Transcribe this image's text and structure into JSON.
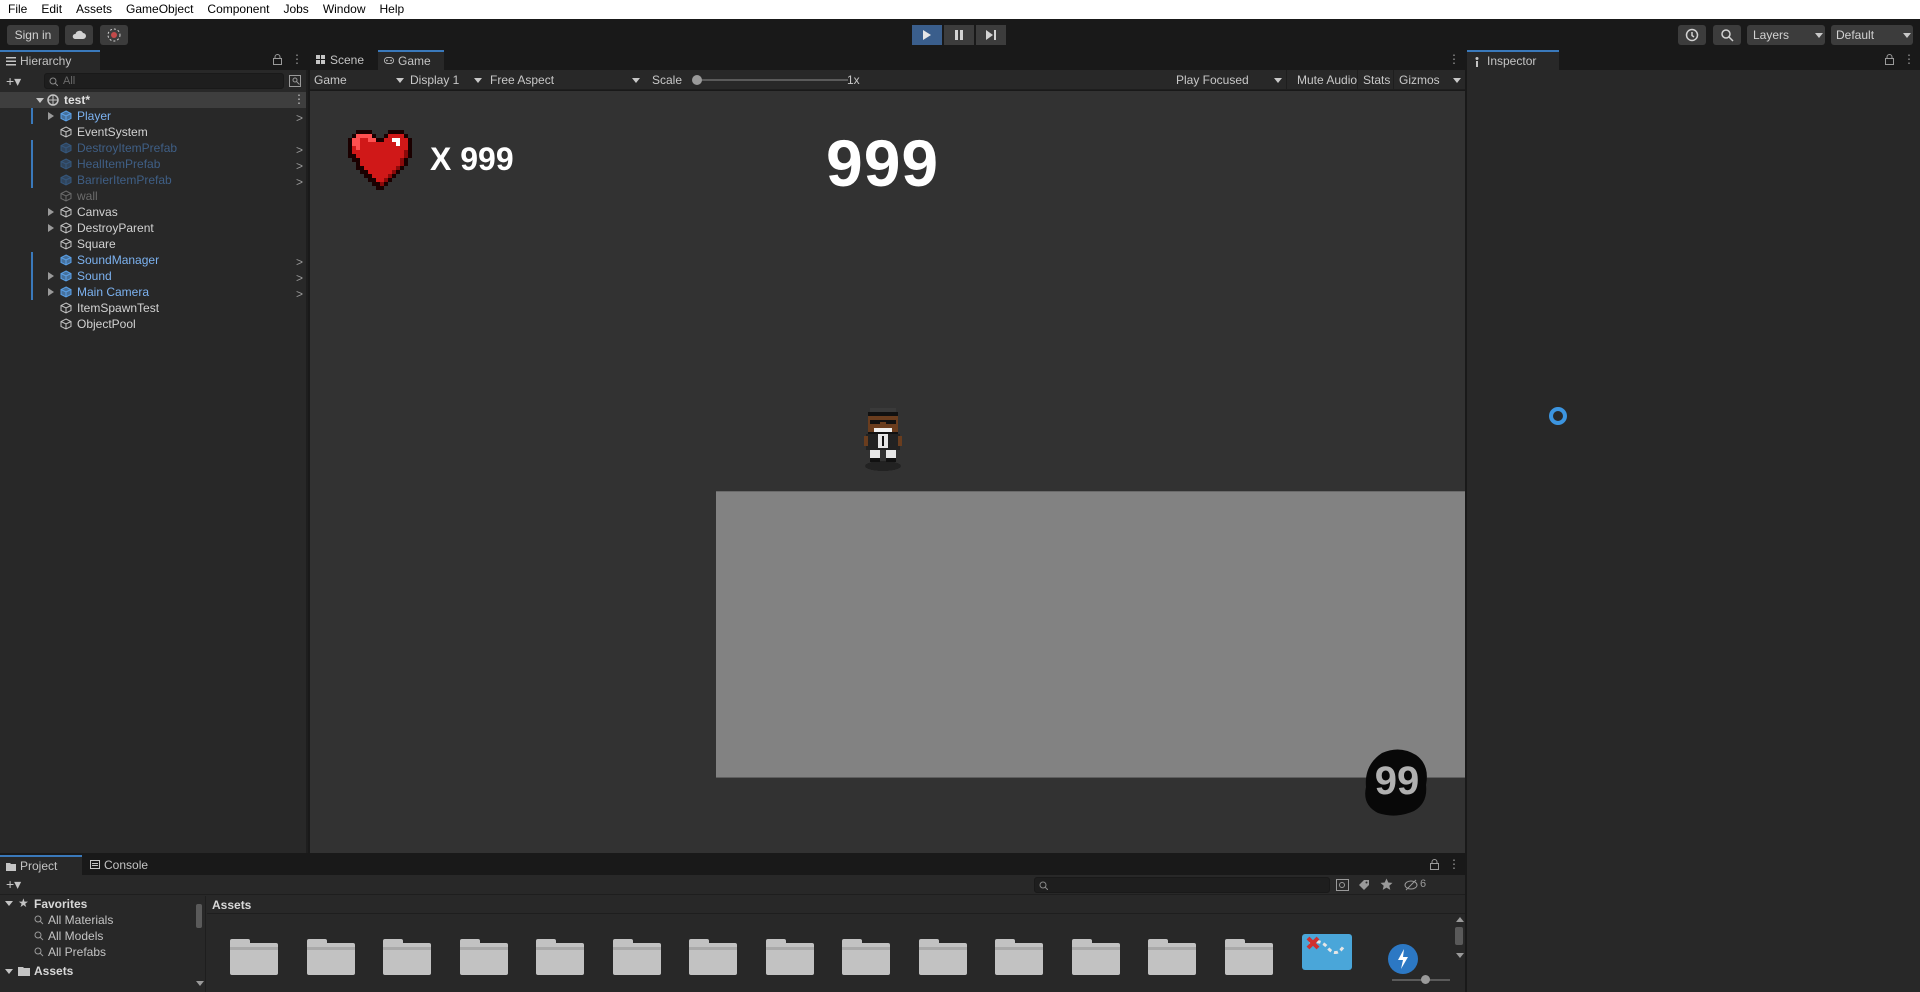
{
  "menu": [
    "File",
    "Edit",
    "Assets",
    "GameObject",
    "Component",
    "Jobs",
    "Window",
    "Help"
  ],
  "toolbar": {
    "sign_in": "Sign in",
    "layers": "Layers",
    "layout": "Default"
  },
  "hierarchy": {
    "tab": "Hierarchy",
    "search_placeholder": "All",
    "scene_name": "test*",
    "items": [
      {
        "label": "Player",
        "kind": "prefab",
        "expandable": true,
        "chevron": true
      },
      {
        "label": "EventSystem",
        "kind": "object",
        "expandable": false,
        "chevron": false
      },
      {
        "label": "DestroyItemPrefab",
        "kind": "prefab-disabled",
        "expandable": false,
        "chevron": true
      },
      {
        "label": "HealItemPrefab",
        "kind": "prefab-disabled",
        "expandable": false,
        "chevron": true
      },
      {
        "label": "BarrierItemPrefab",
        "kind": "prefab-disabled",
        "expandable": false,
        "chevron": true
      },
      {
        "label": "wall",
        "kind": "disabled",
        "expandable": false,
        "chevron": false
      },
      {
        "label": "Canvas",
        "kind": "object",
        "expandable": true,
        "chevron": false
      },
      {
        "label": "DestroyParent",
        "kind": "object",
        "expandable": true,
        "chevron": false
      },
      {
        "label": "Square",
        "kind": "object",
        "expandable": false,
        "chevron": false
      },
      {
        "label": "SoundManager",
        "kind": "prefab",
        "expandable": false,
        "chevron": true
      },
      {
        "label": "Sound",
        "kind": "prefab",
        "expandable": true,
        "chevron": true
      },
      {
        "label": "Main Camera",
        "kind": "prefab",
        "expandable": true,
        "chevron": true
      },
      {
        "label": "ItemSpawnTest",
        "kind": "object",
        "expandable": false,
        "chevron": false
      },
      {
        "label": "ObjectPool",
        "kind": "object",
        "expandable": false,
        "chevron": false
      }
    ]
  },
  "center_tabs": {
    "scene": "Scene",
    "game": "Game"
  },
  "game_toolbar": {
    "mode": "Game",
    "display": "Display 1",
    "aspect": "Free Aspect",
    "scale_label": "Scale",
    "scale_value": "1x",
    "play_focused": "Play Focused",
    "mute_audio": "Mute Audio",
    "stats": "Stats",
    "gizmos": "Gizmos"
  },
  "game": {
    "lives_text": "X 999",
    "score_text": "999",
    "badge_text": "99"
  },
  "inspector": {
    "tab": "Inspector"
  },
  "project": {
    "tab_project": "Project",
    "tab_console": "Console",
    "favorites_title": "Favorites",
    "favorites": [
      "All Materials",
      "All Models",
      "All Prefabs"
    ],
    "assets_root": "Assets",
    "breadcrumb": "Assets",
    "hidden_count": "6",
    "folder_count": 14
  },
  "colors": {
    "accent": "#3a79bb",
    "prefab_text": "#7cb2f0",
    "prefab_disabled_text": "#3f5f86",
    "disabled_text": "#6b6b6b"
  }
}
